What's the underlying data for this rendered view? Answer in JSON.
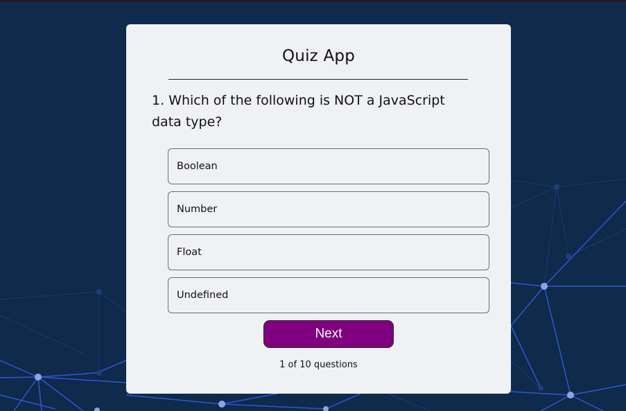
{
  "quiz": {
    "title": "Quiz App",
    "question": "1. Which of the following is NOT a JavaScript data type?",
    "options": [
      "Boolean",
      "Number",
      "Float",
      "Undefined"
    ],
    "next_label": "Next",
    "progress_text": "1 of 10 questions"
  },
  "colors": {
    "background": "#0f2a4a",
    "card": "#f0f1f4",
    "accent": "#800080",
    "network_line": "#2f56d8",
    "network_node": "#8fa4e6"
  }
}
